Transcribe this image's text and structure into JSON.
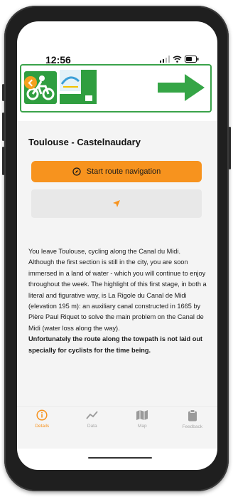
{
  "status_bar": {
    "time": "12:56"
  },
  "route": {
    "title": "Toulouse - Castelnaudary"
  },
  "navigation_button": {
    "label": "Start route navigation"
  },
  "description": {
    "paragraph": "You leave Toulouse, cycling along the Canal du Midi. Although the first section is still in the city, you are soon immersed in a land of water - which you will continue to enjoy throughout the week. The highlight of this first stage, in both a literal and figurative way, is La Rigole du Canal de Midi (elevation 195 m): an auxiliary canal constructed in 1665 by Pière Paul Riquet to solve the main problem on the Canal de Midi (water loss along the way).",
    "bold_note": "Unfortunately the route along the towpath is not laid out specially for cyclists for the time being."
  },
  "tabs": [
    {
      "label": "Details",
      "icon": "info-icon",
      "active": true
    },
    {
      "label": "Data",
      "icon": "chart-icon",
      "active": false
    },
    {
      "label": "Map",
      "icon": "map-icon",
      "active": false
    },
    {
      "label": "Feedback",
      "icon": "clipboard-icon",
      "active": false
    }
  ],
  "colors": {
    "accent": "#f7931e",
    "sign_green": "#3aa34a",
    "background": "#f4f4f4"
  }
}
